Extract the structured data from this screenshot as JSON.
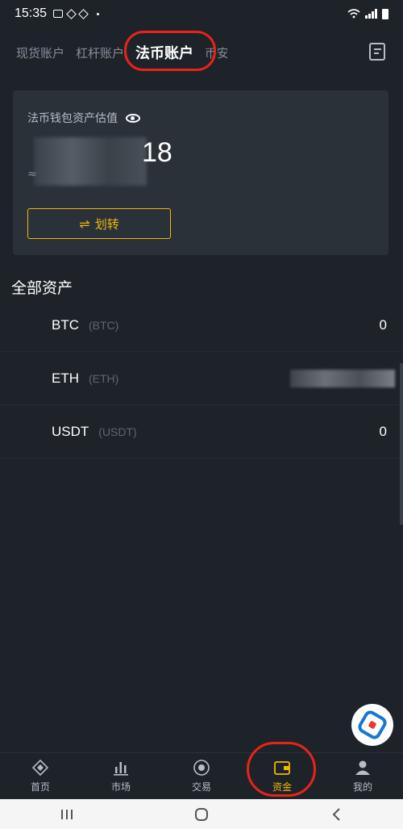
{
  "status_bar": {
    "time": "15:35"
  },
  "tabs": [
    {
      "label": "现货账户"
    },
    {
      "label": "杠杆账户"
    },
    {
      "label": "法币账户"
    },
    {
      "label": "币安"
    }
  ],
  "wallet": {
    "label": "法币钱包资产估值",
    "balance_tail": "18",
    "approx_symbol": "≈",
    "transfer_label": "划转"
  },
  "assets": {
    "section_title": "全部资产",
    "rows": [
      {
        "symbol": "BTC",
        "code": "(BTC)",
        "amount": "0"
      },
      {
        "symbol": "ETH",
        "code": "(ETH)",
        "amount": ""
      },
      {
        "symbol": "USDT",
        "code": "(USDT)",
        "amount": "0"
      }
    ]
  },
  "bottom_nav": [
    {
      "label": "首页",
      "icon": "home-icon"
    },
    {
      "label": "市场",
      "icon": "market-icon"
    },
    {
      "label": "交易",
      "icon": "trade-icon"
    },
    {
      "label": "资金",
      "icon": "wallet-icon"
    },
    {
      "label": "我的",
      "icon": "profile-icon"
    }
  ],
  "colors": {
    "background": "#1e2329",
    "card": "#2b3139",
    "accent": "#f0b90b",
    "highlight": "#e8231a"
  }
}
